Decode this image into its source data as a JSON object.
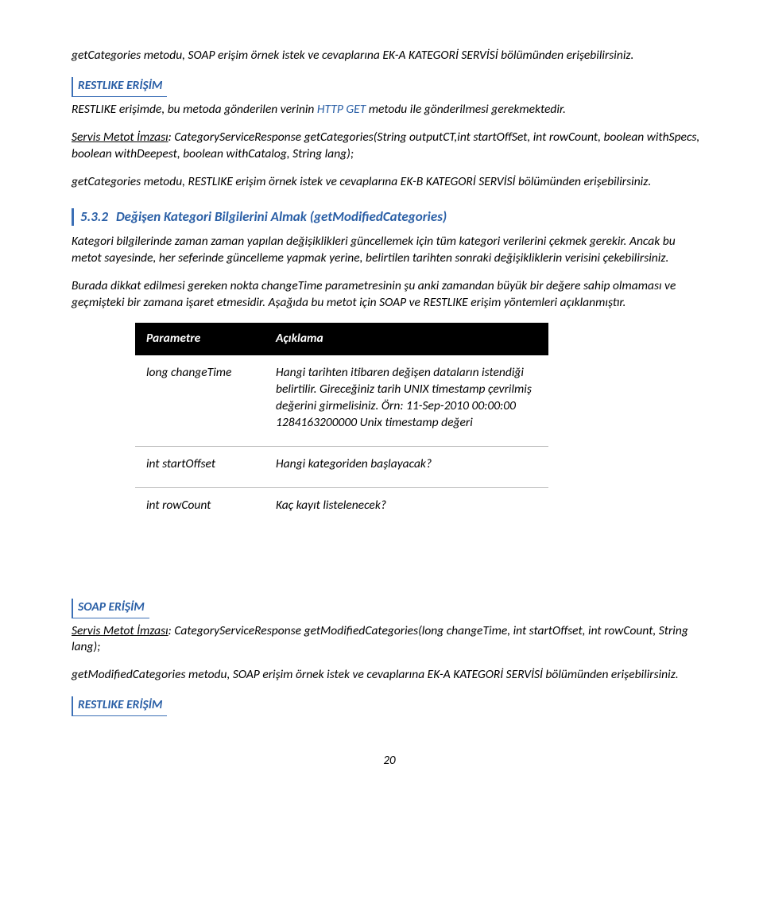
{
  "p1": "getCategories metodu, SOAP erişim örnek istek ve cevaplarına EK-A KATEGORİ SERVİSİ bölümünden erişebilirsiniz.",
  "restlike_header": "RESTLIKE ERİŞİM",
  "p2_a": "RESTLIKE erişimde, bu metoda gönderilen verinin ",
  "p2_b": "HTTP GET",
  "p2_c": " metodu ile gönderilmesi gerekmektedir.",
  "sig_label": "Servis Metot İmzası",
  "sig_1": ": CategoryServiceResponse getCategories(String outputCT,int startOffSet, int rowCount, boolean withSpecs, boolean withDeepest, boolean withCatalog, String lang);",
  "p3": "getCategories metodu, RESTLIKE erişim örnek istek ve cevaplarına EK-B KATEGORİ SERVİSİ bölümünden erişebilirsiniz.",
  "h5_num": "5.3.2",
  "h5_title": "Değişen Kategori Bilgilerini Almak (getModifiedCategories)",
  "p4": "Kategori bilgilerinde zaman zaman yapılan değişiklikleri güncellemek için tüm kategori verilerini çekmek gerekir. Ancak bu metot sayesinde, her seferinde güncelleme yapmak yerine, belirtilen tarihten sonraki değişikliklerin verisini çekebilirsiniz.",
  "p5": "Burada dikkat edilmesi gereken nokta changeTime parametresinin şu anki zamandan büyük bir değere sahip olmaması ve geçmişteki bir zamana işaret etmesidir. Aşağıda bu metot için SOAP ve RESTLIKE erişim yöntemleri açıklanmıştır.",
  "table": {
    "h1": "Parametre",
    "h2": "Açıklama",
    "rows": [
      {
        "p": "long changeTime",
        "d": "Hangi tarihten itibaren değişen dataların istendiği belirtilir. Gireceğiniz tarih UNIX timestamp çevrilmiş değerini girmelisiniz. Örn: 11-Sep-2010 00:00:00 1284163200000 Unix timestamp değeri"
      },
      {
        "p": "int startOffset",
        "d": "Hangi kategoriden başlayacak?"
      },
      {
        "p": "int rowCount",
        "d": "Kaç kayıt listelenecek?"
      }
    ]
  },
  "soap_header": "SOAP ERİŞİM",
  "sig_2": ": CategoryServiceResponse getModifiedCategories(long changeTime, int startOffset, int rowCount, String lang);",
  "p6": "getModifiedCategories metodu, SOAP erişim örnek istek ve cevaplarına EK-A KATEGORİ SERVİSİ bölümünden erişebilirsiniz.",
  "restlike_header2": "RESTLIKE ERİŞİM",
  "page_num": "20"
}
